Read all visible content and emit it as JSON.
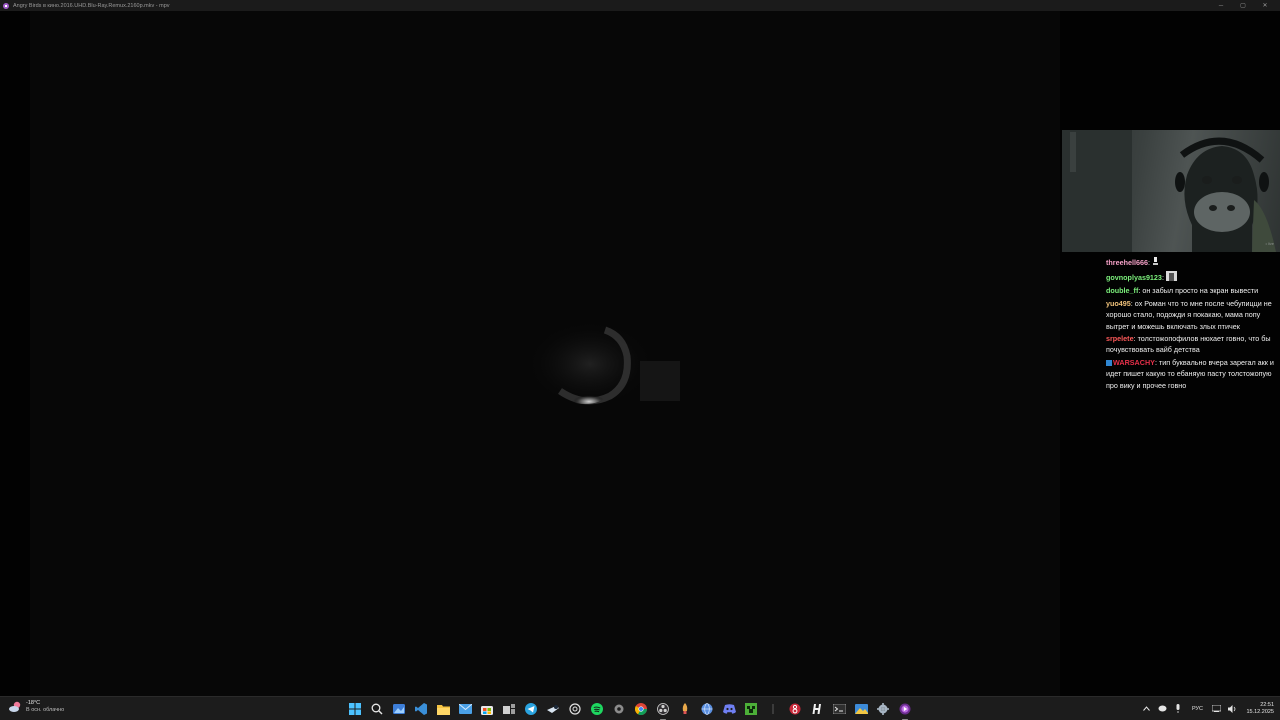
{
  "window": {
    "title": "Angry Birds в кино.2016.UHD.Blu-Ray.Remux.2160p.mkv - mpv",
    "controls": {
      "minimize": "─",
      "maximize": "▢",
      "close": "✕"
    }
  },
  "webcam": {
    "stamp": "• live"
  },
  "chat": {
    "messages": [
      {
        "user": "threehell666",
        "color": "#f6a2c8",
        "text": "",
        "emote": "trophy"
      },
      {
        "user": "govnoplyas9123",
        "color": "#7cf07c",
        "text": "",
        "emote": "meme"
      },
      {
        "user": "double_ff",
        "color": "#7cf07c",
        "text": "он забыл просто на экран вывести"
      },
      {
        "user": "yuo495",
        "color": "#f0c27a",
        "text": "ох Роман что то мне после чебупицци не хорошо стало, подожди я покакаю, мама попу вытрет и можешь включать злых птичек"
      },
      {
        "user": "srpelete",
        "color": "#ff5a5a",
        "text": "толстожопофилов нюхает говно, что бы почувствовать вайб детства"
      },
      {
        "user": "WARSACHY",
        "color": "#e8304a",
        "badge": true,
        "text": "тип буквально вчера зарегал акк и идет пишет какую то ебаняую пасту толстожопую про вику и прочее говно"
      }
    ]
  },
  "taskbar": {
    "weather": {
      "temp": "-18°C",
      "desc": "В осн. облачно"
    },
    "apps": [
      "windows-start-icon",
      "search-icon",
      "widgets-icon",
      "vscode-icon",
      "file-explorer-icon",
      "mail-icon",
      "store-icon",
      "task-view-icon",
      "telegram-icon",
      "steam-icon",
      "chatgpt-icon",
      "spotify-icon",
      "settings-cog-icon",
      "chrome-icon",
      "obs-icon",
      "rocket-icon",
      "globe-icon",
      "discord-icon",
      "minecraft-icon",
      "separator-icon",
      "app-8-icon",
      "h-app-icon",
      "terminal-icon",
      "photos-icon",
      "gear-icon",
      "mpv-icon"
    ],
    "tray": {
      "lang": "РУС",
      "time": "22:51",
      "date": "15.12.2025"
    }
  }
}
